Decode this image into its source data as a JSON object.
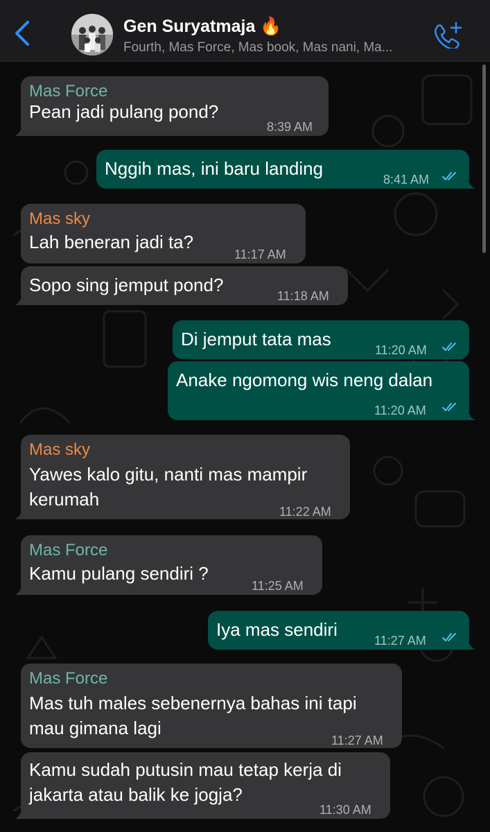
{
  "header": {
    "title": "Gen Suryatmaja 🔥",
    "subtitle": "Fourth, Mas Force, Mas book, Mas nani, Ma..."
  },
  "colors": {
    "incoming_bubble": "#363638",
    "outgoing_bubble": "#005046",
    "sender_teal": "#6fb6a3",
    "sender_orange": "#ea8a45",
    "tick_blue": "#53bdeb",
    "icon_blue": "#2f8ff5"
  },
  "messages": [
    {
      "dir": "in",
      "sender": "Mas Force",
      "lines": [
        "Pean jadi pulang pond?"
      ],
      "time": "8:39 AM"
    },
    {
      "dir": "out",
      "lines": [
        "Nggih mas, ini baru landing"
      ],
      "time": "8:41 AM",
      "status": "read"
    },
    {
      "dir": "in",
      "sender": "Mas sky",
      "lines": [
        "Lah beneran jadi ta?"
      ],
      "time": "11:17 AM"
    },
    {
      "dir": "in",
      "lines": [
        "Sopo sing jemput pond?"
      ],
      "time": "11:18 AM"
    },
    {
      "dir": "out",
      "lines": [
        "Di jemput tata mas"
      ],
      "time": "11:20 AM",
      "status": "read"
    },
    {
      "dir": "out",
      "lines": [
        "Anake ngomong wis neng dalan"
      ],
      "time": "11:20 AM",
      "status": "read"
    },
    {
      "dir": "in",
      "sender": "Mas sky",
      "lines": [
        "Yawes kalo gitu, nanti mas mampir",
        "kerumah"
      ],
      "time": "11:22 AM"
    },
    {
      "dir": "in",
      "sender": "Mas Force",
      "lines": [
        "Kamu pulang sendiri ?"
      ],
      "time": "11:25 AM"
    },
    {
      "dir": "out",
      "lines": [
        "Iya mas sendiri"
      ],
      "time": "11:27 AM",
      "status": "read"
    },
    {
      "dir": "in",
      "sender": "Mas Force",
      "lines": [
        "Mas tuh males sebenernya bahas ini tapi",
        "mau gimana lagi"
      ],
      "time": "11:27 AM"
    },
    {
      "dir": "in",
      "lines": [
        "Kamu sudah putusin mau tetap kerja di",
        "jakarta atau balik ke jogja?"
      ],
      "time": "11:30 AM"
    }
  ]
}
